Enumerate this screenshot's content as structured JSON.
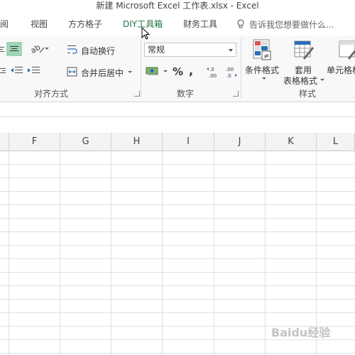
{
  "window": {
    "title": "新建 Microsoft Excel 工作表.xlsx - Excel"
  },
  "tabs": [
    {
      "label": "阅"
    },
    {
      "label": "视图"
    },
    {
      "label": "方方格子"
    },
    {
      "label": "DIY工具箱",
      "active": true
    },
    {
      "label": "财务工具"
    }
  ],
  "tell_me": {
    "placeholder": "告诉我您想要做什么..."
  },
  "ribbon": {
    "alignment": {
      "label": "对齐方式",
      "wrap_text": "自动换行",
      "merge_center": "合并后居中"
    },
    "number": {
      "label": "数字",
      "format_value": "常规",
      "percent_symbol": "%",
      "comma_symbol": ",",
      "increase_decimal": "←.0 .00",
      "decrease_decimal": ".00 →.0"
    },
    "styles": {
      "label": "样式",
      "conditional_format": "条件格式",
      "format_as_table_line1": "套用",
      "format_as_table_line2": "表格格式",
      "cell_styles": "单元格格"
    }
  },
  "grid": {
    "columns": [
      "F",
      "G",
      "H",
      "I",
      "J",
      "K",
      "L"
    ]
  },
  "watermark": {
    "text": "Baidu经验"
  },
  "colors": {
    "accent": "#217346",
    "selected_button": "#9fd5b7"
  }
}
